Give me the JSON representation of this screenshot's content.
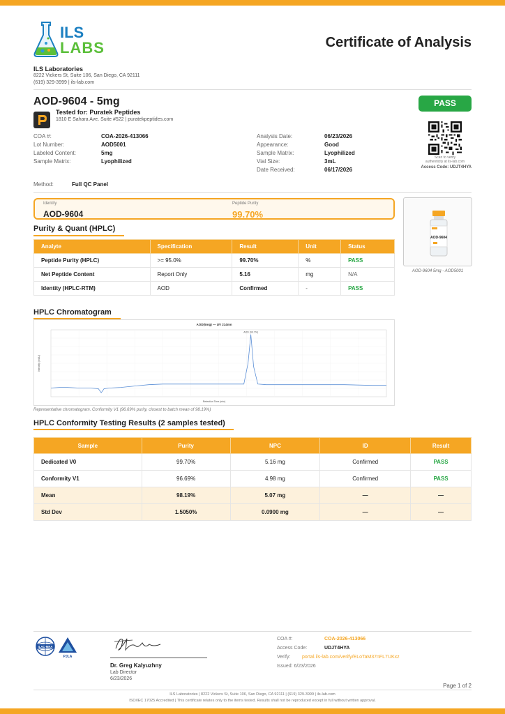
{
  "brand": {
    "logo_text_top": "ILS",
    "logo_text_bottom": "LABS",
    "accent": "#f5a623",
    "pass_color": "#28a745"
  },
  "header": {
    "title": "Certificate of Analysis",
    "lab_name": "ILS Laboratories",
    "lab_address": "8222 Vickers St, Suite 106, San Diego, CA 92111",
    "lab_contact": "(619) 329-3999  |  ils-lab.com"
  },
  "product": {
    "name": "AOD-9604 - 5mg",
    "status": "PASS",
    "tested_for": "Tested for: Puratek Peptides",
    "client_address": "1810 E Sahara Ave. Suite #522  |  puratekpeptides.com"
  },
  "details_left": [
    {
      "k": "COA #:",
      "v": "COA-2026-413066"
    },
    {
      "k": "Lot Number:",
      "v": "AOD5001"
    },
    {
      "k": "Labeled Content:",
      "v": "5mg"
    },
    {
      "k": "Sample Matrix:",
      "v": "Lyophilized"
    }
  ],
  "details_right": [
    {
      "k": "Analysis Date:",
      "v": "06/23/2026"
    },
    {
      "k": "Appearance:",
      "v": "Good"
    },
    {
      "k": "Sample Matrix:",
      "v": "Lyophilized"
    },
    {
      "k": "Vial Size:",
      "v": "3mL"
    },
    {
      "k": "Date Received:",
      "v": "06/17/2026"
    }
  ],
  "qr": {
    "caption_1": "Scan to verify",
    "caption_2": "authenticity at ils-lab.com",
    "access_code": "Access Code: UDJT4HYA"
  },
  "method": {
    "k": "Method:",
    "v": "Full QC Panel"
  },
  "highlight": {
    "identity_label": "Identity",
    "identity_value": "AOD-9604",
    "purity_label": "Peptide Purity",
    "purity_value": "99.70%"
  },
  "purity_section": {
    "title": "Purity & Quant (HPLC)",
    "headers": [
      "Analyte",
      "Specification",
      "Result",
      "Unit",
      "Status"
    ],
    "rows": [
      [
        "Peptide Purity (HPLC)",
        ">= 95.0%",
        "99.70%",
        "%",
        "PASS"
      ],
      [
        "Net Peptide Content",
        "Report Only",
        "5.16",
        "mg",
        "N/A"
      ],
      [
        "Identity (HPLC-RTM)",
        "AOD",
        "Confirmed",
        "-",
        "PASS"
      ]
    ]
  },
  "photo": {
    "vial_label": "AOD-9604",
    "caption": "AOD-9604 5mg - AOD5001"
  },
  "chromatogram": {
    "title": "HPLC Chromatogram",
    "caption": "Representative chromatogram. Conformity V1 (96.69% purity, closest to batch mean of 98.19%)"
  },
  "chart_data": {
    "type": "line",
    "title": "AOD(5mg) — UV 214nm",
    "xlabel": "Retention Time (min)",
    "ylabel": "Intensity (mAU)",
    "peak_label": "AOD (99.7%)",
    "xlim": [
      0,
      12
    ],
    "ylim": [
      0,
      1
    ],
    "x": [
      0,
      0.3,
      0.6,
      1.0,
      1.4,
      1.7,
      1.8,
      1.9,
      2.1,
      2.5,
      3.0,
      3.5,
      4.0,
      5.0,
      6.0,
      6.9,
      7.05,
      7.15,
      7.25,
      7.4,
      7.7,
      8.5,
      9.5,
      10.5,
      11.5,
      12
    ],
    "values": [
      0.13,
      0.14,
      0.14,
      0.13,
      0.13,
      0.12,
      0.06,
      0.12,
      0.13,
      0.14,
      0.16,
      0.18,
      0.19,
      0.19,
      0.19,
      0.19,
      0.5,
      0.93,
      0.45,
      0.19,
      0.18,
      0.18,
      0.18,
      0.18,
      0.17,
      0.17
    ]
  },
  "conformity_section": {
    "title": "HPLC Conformity Testing Results (2 samples tested)",
    "headers": [
      "Sample",
      "Purity",
      "NPC",
      "ID",
      "Result"
    ],
    "rows": [
      [
        "Dedicated V0",
        "99.70%",
        "5.16 mg",
        "Confirmed",
        "PASS"
      ],
      [
        "Conformity V1",
        "96.69%",
        "4.98 mg",
        "Confirmed",
        "PASS"
      ],
      [
        "Mean",
        "98.19%",
        "5.07 mg",
        "—",
        "—"
      ],
      [
        "Std Dev",
        "1.5050%",
        "0.0900 mg",
        "—",
        "—"
      ]
    ]
  },
  "footer": {
    "accreditation_1": "ILAC-MRA",
    "accreditation_2": "PJLA",
    "signer_name": "Dr. Greg Kalyuzhny",
    "signer_title": "Lab Director",
    "signer_date": "6/23/2026",
    "coa_k": "COA #:",
    "coa_v": "COA-2026-413066",
    "access_k": "Access Code:",
    "access_v": "UDJT4HYA",
    "verify_k": "Verify:",
    "verify_v": "portal.ils-lab.com/verify/ELoTaM37nFL7UKxz",
    "issued": "Issued: 6/23/2026",
    "page": "Page 1 of 2",
    "fine_1": "ILS Laboratories  |  8222 Vickers St, Suite 106, San Diego, CA 92111  |  (619) 329-3999  |  ils-lab.com",
    "fine_2": "ISO/IEC 17025 Accredited  |  This certificate relates only to the items tested. Results shall not be reproduced except in full without written approval."
  }
}
